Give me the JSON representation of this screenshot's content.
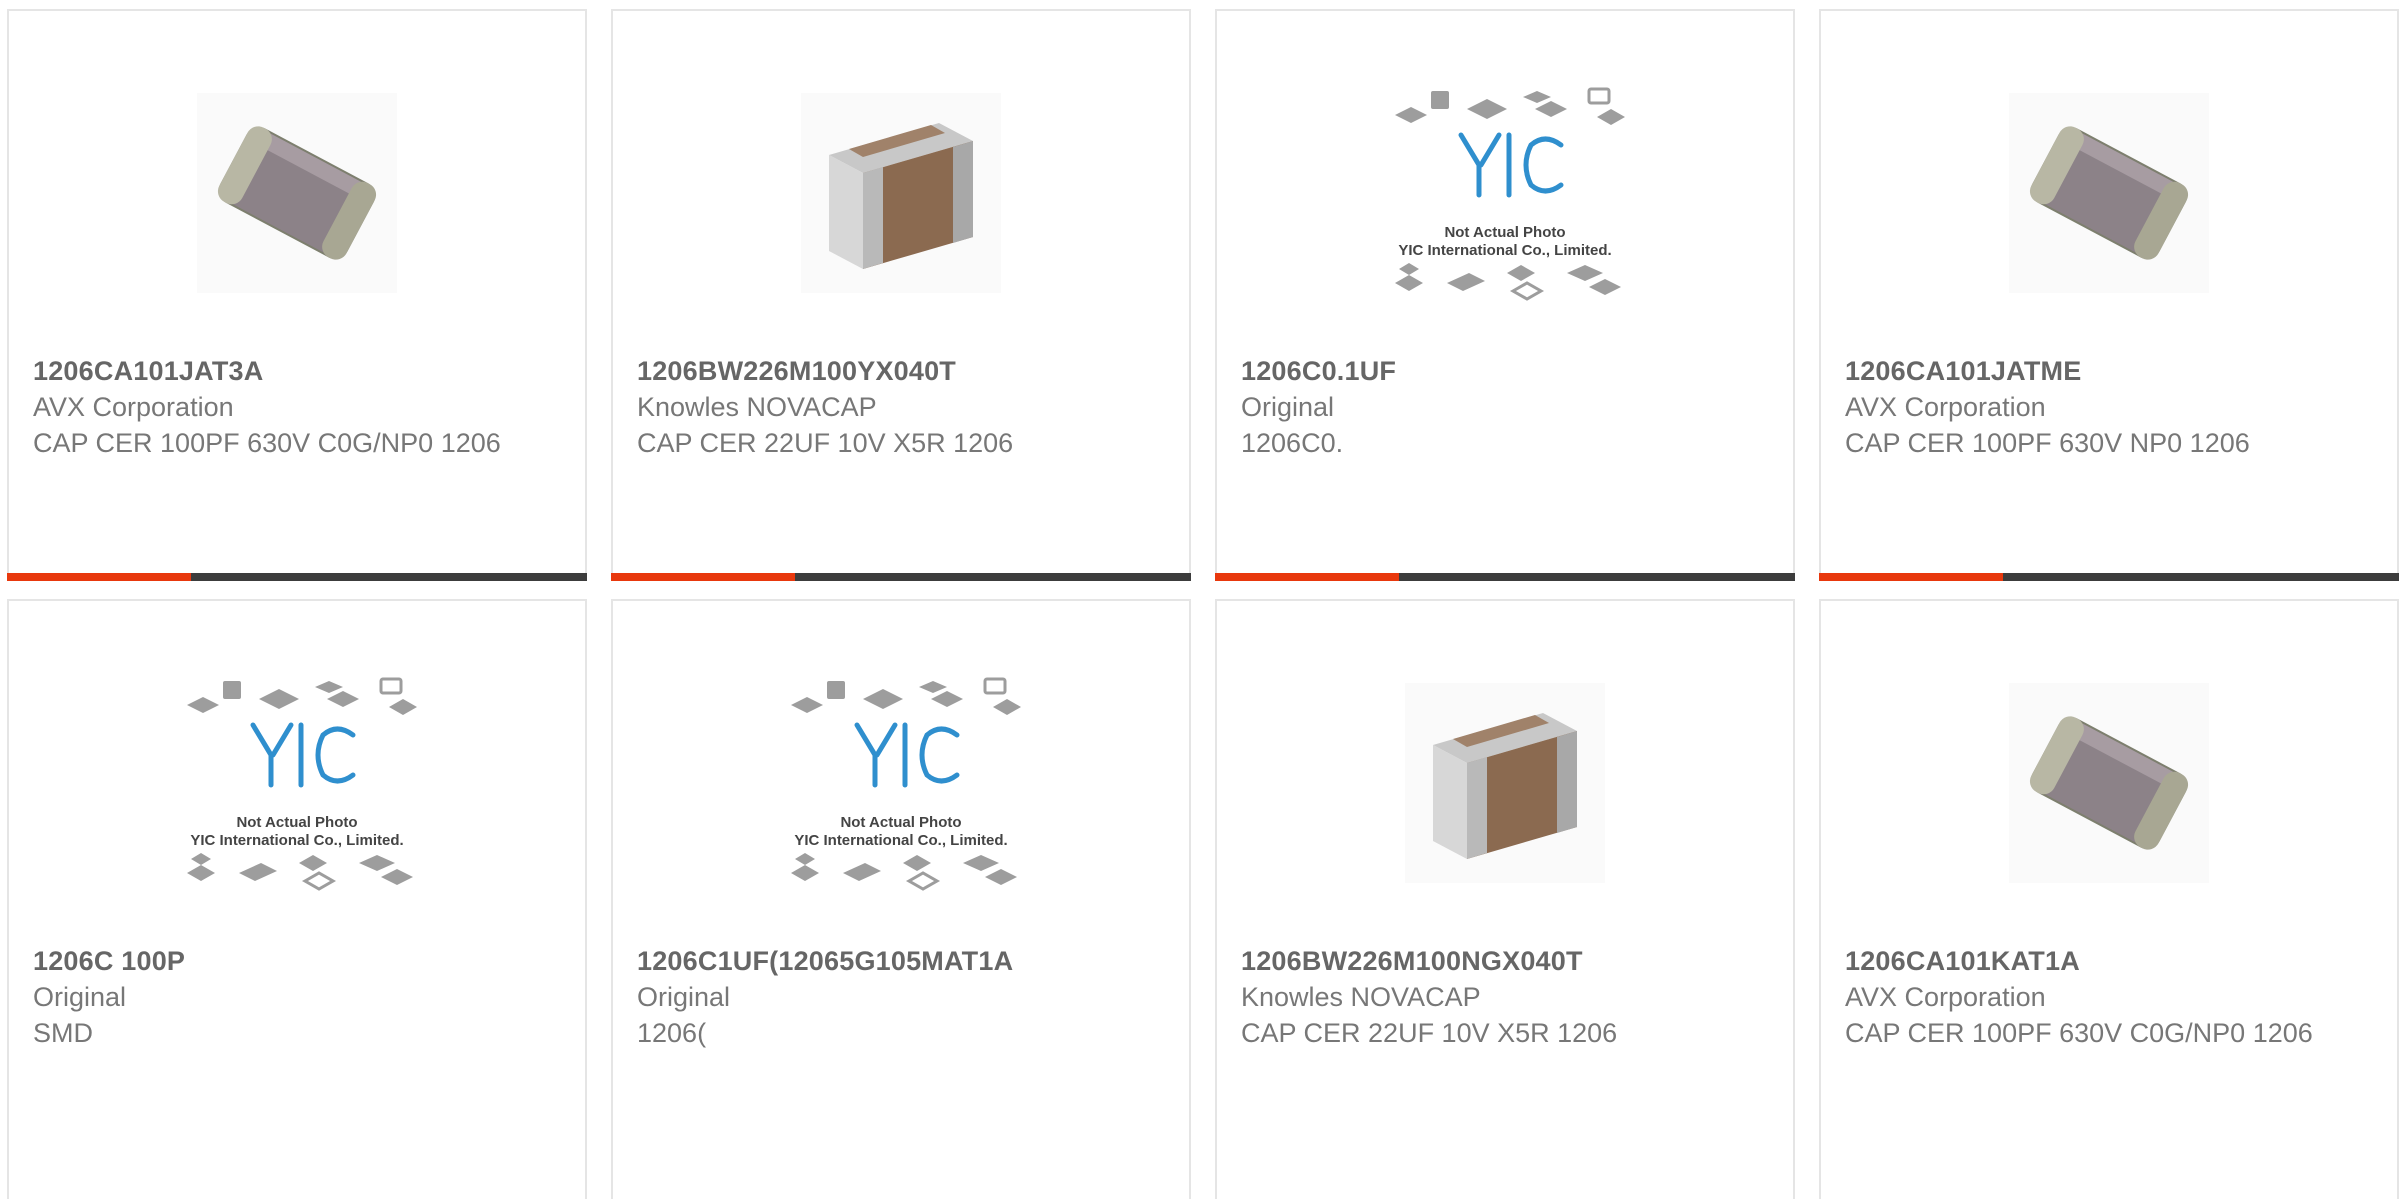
{
  "products": [
    {
      "part": "1206CA101JAT3A",
      "manufacturer": "AVX Corporation",
      "description": "CAP CER 100PF 630V C0G/NP0 1206",
      "image": "mlcc-chip-silver-icon"
    },
    {
      "part": "1206BW226M100YX040T",
      "manufacturer": "Knowles NOVACAP",
      "description": "CAP CER 22UF 10V X5R 1206",
      "image": "mlcc-chip-brown-icon"
    },
    {
      "part": "1206C0.1UF",
      "manufacturer": "Original",
      "description": "1206C0.",
      "image": "yic-placeholder-icon"
    },
    {
      "part": "1206CA101JATME",
      "manufacturer": "AVX Corporation",
      "description": "CAP CER 100PF 630V NP0 1206",
      "image": "mlcc-chip-silver-icon"
    },
    {
      "part": "1206C 100P",
      "manufacturer": "Original",
      "description": "SMD",
      "image": "yic-placeholder-icon"
    },
    {
      "part": "1206C1UF(12065G105MAT1A",
      "manufacturer": "Original",
      "description": "1206(",
      "image": "yic-placeholder-icon"
    },
    {
      "part": "1206BW226M100NGX040T",
      "manufacturer": "Knowles NOVACAP",
      "description": "CAP CER 22UF 10V X5R 1206",
      "image": "mlcc-chip-brown-icon"
    },
    {
      "part": "1206CA101KAT1A",
      "manufacturer": "AVX Corporation",
      "description": "CAP CER 100PF 630V C0G/NP0 1206",
      "image": "mlcc-chip-silver-icon"
    }
  ],
  "placeholder": {
    "line1": "Not Actual Photo",
    "line2": "YIC International Co., Limited.",
    "logo": "YIC"
  },
  "colors": {
    "accent": "#e8380d",
    "bar": "#3c3c3c",
    "border": "#e5e5e5"
  }
}
